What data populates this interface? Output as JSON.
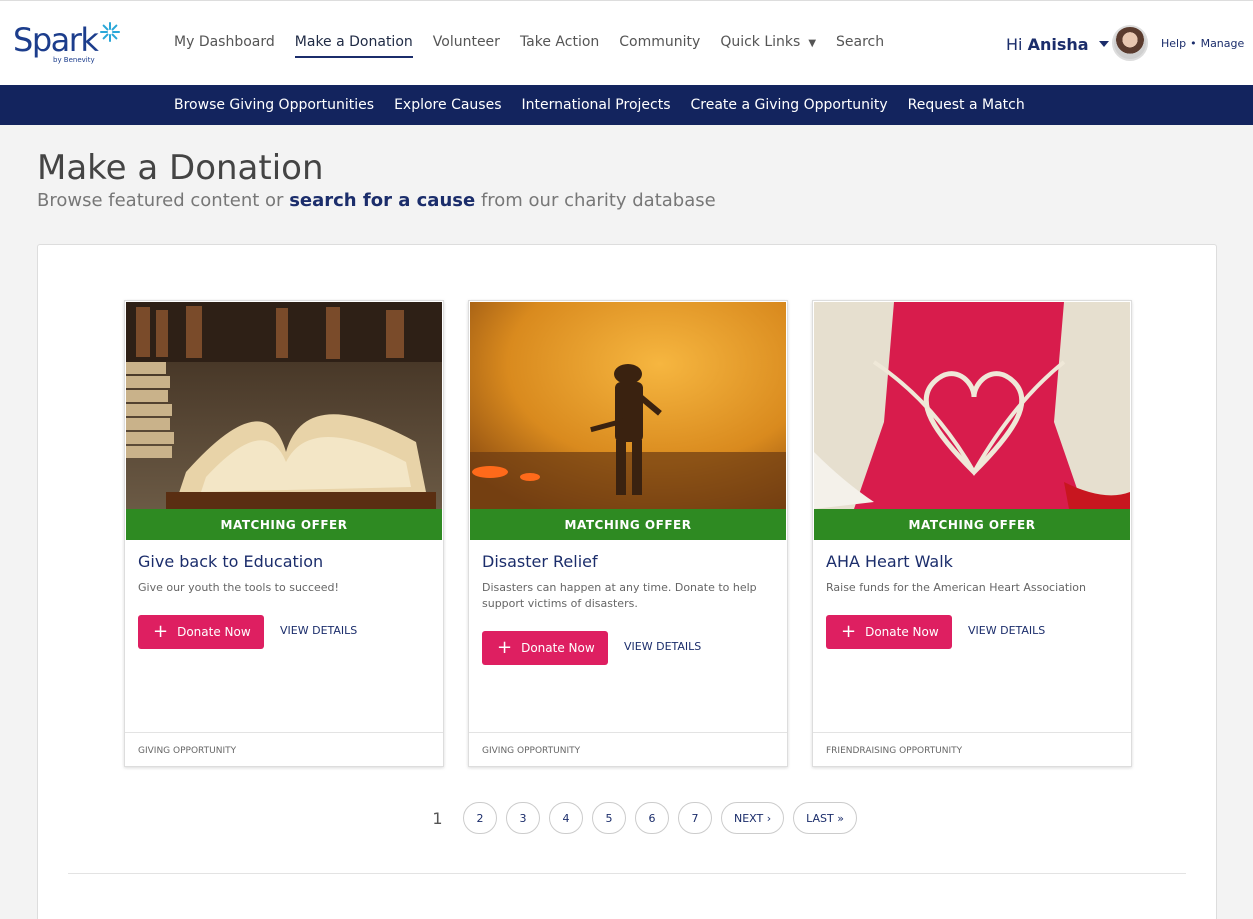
{
  "header": {
    "logo_text": "Spark",
    "logo_sub": "by Benevity",
    "nav": [
      {
        "label": "My Dashboard"
      },
      {
        "label": "Make a Donation",
        "active": true
      },
      {
        "label": "Volunteer"
      },
      {
        "label": "Take Action"
      },
      {
        "label": "Community"
      },
      {
        "label": "Quick Links",
        "dropdown": true
      },
      {
        "label": "Search"
      }
    ],
    "greeting_prefix": "Hi",
    "user_name": "Anisha",
    "help_label": "Help",
    "separator": "•",
    "manage_label": "Manage"
  },
  "subnav": [
    {
      "label": "Browse Giving Opportunities"
    },
    {
      "label": "Explore Causes"
    },
    {
      "label": "International Projects"
    },
    {
      "label": "Create a Giving Opportunity"
    },
    {
      "label": "Request a Match"
    }
  ],
  "page": {
    "title": "Make a Donation",
    "subtitle_before": "Browse featured content or",
    "subtitle_link": "search for a cause",
    "subtitle_after": "from our charity database"
  },
  "cards": [
    {
      "badge": "MATCHING OFFER",
      "title": "Give back to Education",
      "description": "Give our youth the tools to succeed!",
      "donate_label": "Donate Now",
      "details_label": "VIEW DETAILS",
      "footer": "GIVING OPPORTUNITY"
    },
    {
      "badge": "MATCHING OFFER",
      "title": "Disaster Relief",
      "description": "Disasters can happen at any time. Donate to help support victims of disasters.",
      "donate_label": "Donate Now",
      "details_label": "VIEW DETAILS",
      "footer": "GIVING OPPORTUNITY"
    },
    {
      "badge": "MATCHING OFFER",
      "title": "AHA Heart Walk",
      "description": "Raise funds for the American Heart Association",
      "donate_label": "Donate Now",
      "details_label": "VIEW DETAILS",
      "footer": "FRIENDRAISING OPPORTUNITY"
    }
  ],
  "pagination": {
    "current": "1",
    "pages": [
      "2",
      "3",
      "4",
      "5",
      "6",
      "7"
    ],
    "next_label": "NEXT ›",
    "last_label": "LAST »"
  },
  "colors": {
    "brand_navy": "#13245e",
    "donate_pink": "#de1f61",
    "match_green": "#2e8a22"
  }
}
